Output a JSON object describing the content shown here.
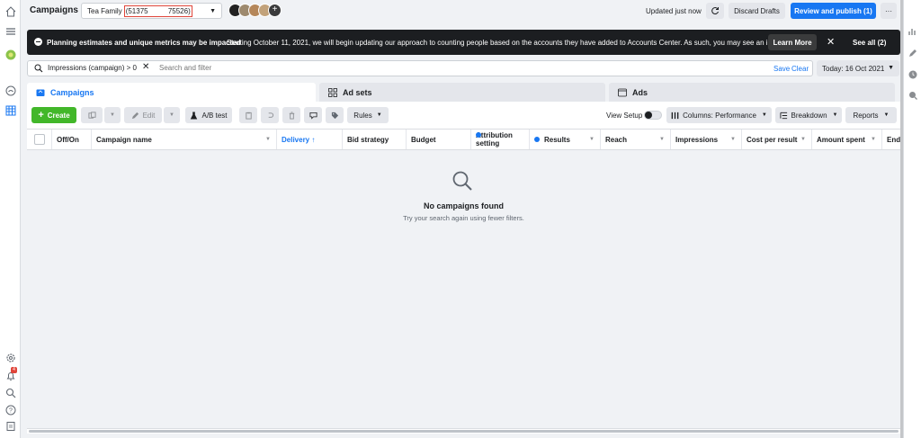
{
  "topbar": {
    "title": "Campaigns",
    "account_name": "Tea Family",
    "account_id": "(51375          75526)",
    "updated": "Updated just now",
    "discard": "Discard Drafts",
    "publish": "Review and publish (1)",
    "more": "···"
  },
  "banner": {
    "bold": "Planning estimates and unique metrics may be impacted",
    "text": "Starting October 11, 2021, we will begin updating our approach to counting people based on the accounts they have added to Accounts Center. As such, you may see an impact t...",
    "learn_more": "Learn More",
    "close": "✕",
    "see_all": "See all (2)"
  },
  "search": {
    "chip": "Impressions (campaign) > 0",
    "chip_close": "✕",
    "placeholder": "Search and filter",
    "save": "Save",
    "clear": "Clear"
  },
  "date": {
    "label": "Today: 16 Oct 2021"
  },
  "tabs": [
    {
      "label": "Campaigns",
      "icon": "folder-icon"
    },
    {
      "label": "Ad sets",
      "icon": "grid-icon"
    },
    {
      "label": "Ads",
      "icon": "ad-icon"
    }
  ],
  "toolbar": {
    "create": "Create",
    "edit": "Edit",
    "ab_test": "A/B test",
    "rules": "Rules",
    "view_setup": "View Setup",
    "columns": "Columns: Performance",
    "breakdown": "Breakdown",
    "reports": "Reports"
  },
  "table": {
    "columns": [
      "Off/On",
      "Campaign name",
      "Delivery ↑",
      "Bid strategy",
      "Budget",
      "Attribution setting",
      "Results",
      "Reach",
      "Impressions",
      "Cost per result",
      "Amount spent",
      "End"
    ]
  },
  "empty": {
    "title": "No campaigns found",
    "subtitle": "Try your search again using fewer filters."
  },
  "colors": {
    "accent": "#1877f2",
    "create": "#42b72a",
    "banner": "#1c1e21",
    "notification": "#e0453a"
  },
  "notifications": {
    "count": "4"
  }
}
